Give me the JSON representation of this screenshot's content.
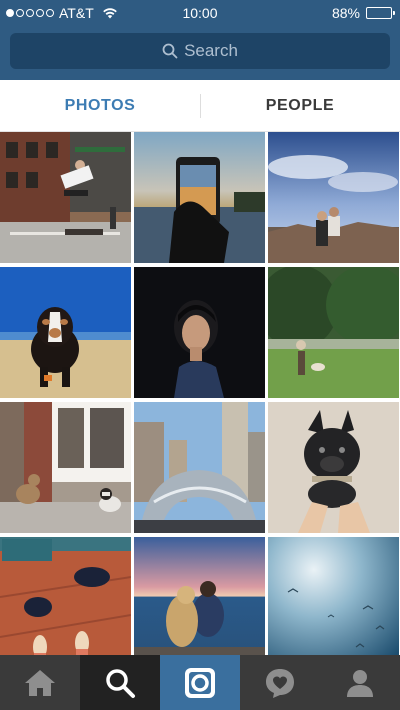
{
  "status_bar": {
    "carrier": "AT&T",
    "time": "10:00",
    "battery": "88%",
    "battery_level": 0.88
  },
  "search": {
    "placeholder": "Search"
  },
  "tabs": [
    {
      "label": "PHOTOS",
      "active": true
    },
    {
      "label": "PEOPLE",
      "active": false
    }
  ],
  "colors": {
    "header": "#2f5b82",
    "search_field": "#1e4466",
    "active_tab": "#3d7cb3",
    "nav_bar": "#3a3a3a",
    "nav_active": "#3a6f9e"
  },
  "grid": {
    "tiles": [
      {
        "id": "photo-skater-street"
      },
      {
        "id": "photo-phone-sunset"
      },
      {
        "id": "photo-canyon-couple"
      },
      {
        "id": "photo-dog-beach"
      },
      {
        "id": "photo-woman-portrait"
      },
      {
        "id": "photo-park-dog"
      },
      {
        "id": "photo-dogs-sidewalk"
      },
      {
        "id": "photo-cloud-gate"
      },
      {
        "id": "photo-french-bulldog"
      },
      {
        "id": "photo-wooden-floor"
      },
      {
        "id": "photo-woman-dog-sea"
      },
      {
        "id": "photo-sky-birds"
      }
    ]
  },
  "nav": [
    {
      "icon": "home-icon"
    },
    {
      "icon": "search-icon",
      "current": true
    },
    {
      "icon": "camera-icon"
    },
    {
      "icon": "activity-heart-icon"
    },
    {
      "icon": "profile-icon"
    }
  ]
}
